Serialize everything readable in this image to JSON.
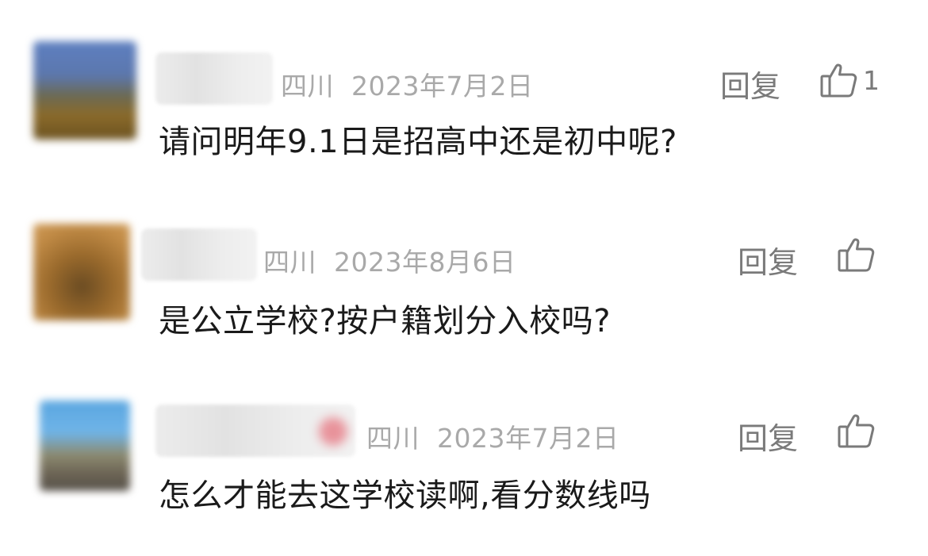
{
  "comments": [
    {
      "location": "四川",
      "date": "2023年7月2日",
      "reply_label": "回复",
      "like_count": "1",
      "text": "请问明年9.1日是招高中还是初中呢?"
    },
    {
      "location": "四川",
      "date": "2023年8月6日",
      "reply_label": "回复",
      "like_count": "",
      "text": "是公立学校?按户籍划分入校吗?"
    },
    {
      "location": "四川",
      "date": "2023年7月2日",
      "reply_label": "回复",
      "like_count": "",
      "text": "怎么才能去这学校读啊,看分数线吗"
    }
  ],
  "colors": {
    "meta_text": "#a9a9a9",
    "action_text": "#7a7a7a",
    "body_text": "#1a1a1a"
  },
  "icons": {
    "like": "thumbs-up-icon"
  }
}
